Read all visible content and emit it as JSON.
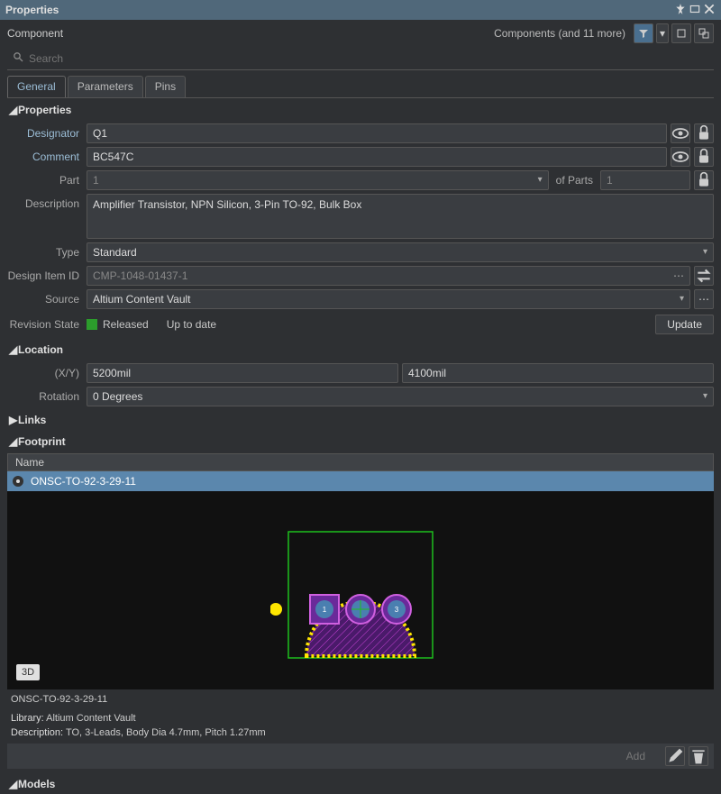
{
  "panelTitle": "Properties",
  "header": {
    "label": "Component",
    "filterInfo": "Components (and 11 more)"
  },
  "search": {
    "placeholder": "Search"
  },
  "tabs": {
    "general": "General",
    "parameters": "Parameters",
    "pins": "Pins"
  },
  "sections": {
    "properties": "Properties",
    "location": "Location",
    "links": "Links",
    "footprint": "Footprint",
    "models": "Models"
  },
  "labels": {
    "designator": "Designator",
    "comment": "Comment",
    "part": "Part",
    "ofParts": "of Parts",
    "description": "Description",
    "type": "Type",
    "designItemId": "Design Item ID",
    "source": "Source",
    "revisionState": "Revision State",
    "xy": "(X/Y)",
    "rotation": "Rotation",
    "name": "Name",
    "library": "Library:",
    "descriptionShort": "Description:"
  },
  "values": {
    "designator": "Q1",
    "comment": "BC547C",
    "part": "1",
    "ofParts": "1",
    "description": "Amplifier Transistor, NPN Silicon, 3-Pin TO-92, Bulk Box",
    "type": "Standard",
    "designItemId": "CMP-1048-01437-1",
    "source": "Altium Content Vault",
    "released": "Released",
    "uptodate": "Up to date",
    "x": "5200mil",
    "y": "4100mil",
    "rotation": "0 Degrees"
  },
  "buttons": {
    "update": "Update",
    "add": "Add",
    "threeD": "3D"
  },
  "footprint": {
    "name": "ONSC-TO-92-3-29-11",
    "displayName": "ONSC-TO-92-3-29-11",
    "library": "Altium Content Vault",
    "description": "TO, 3-Leads, Body Dia 4.7mm, Pitch 1.27mm"
  }
}
